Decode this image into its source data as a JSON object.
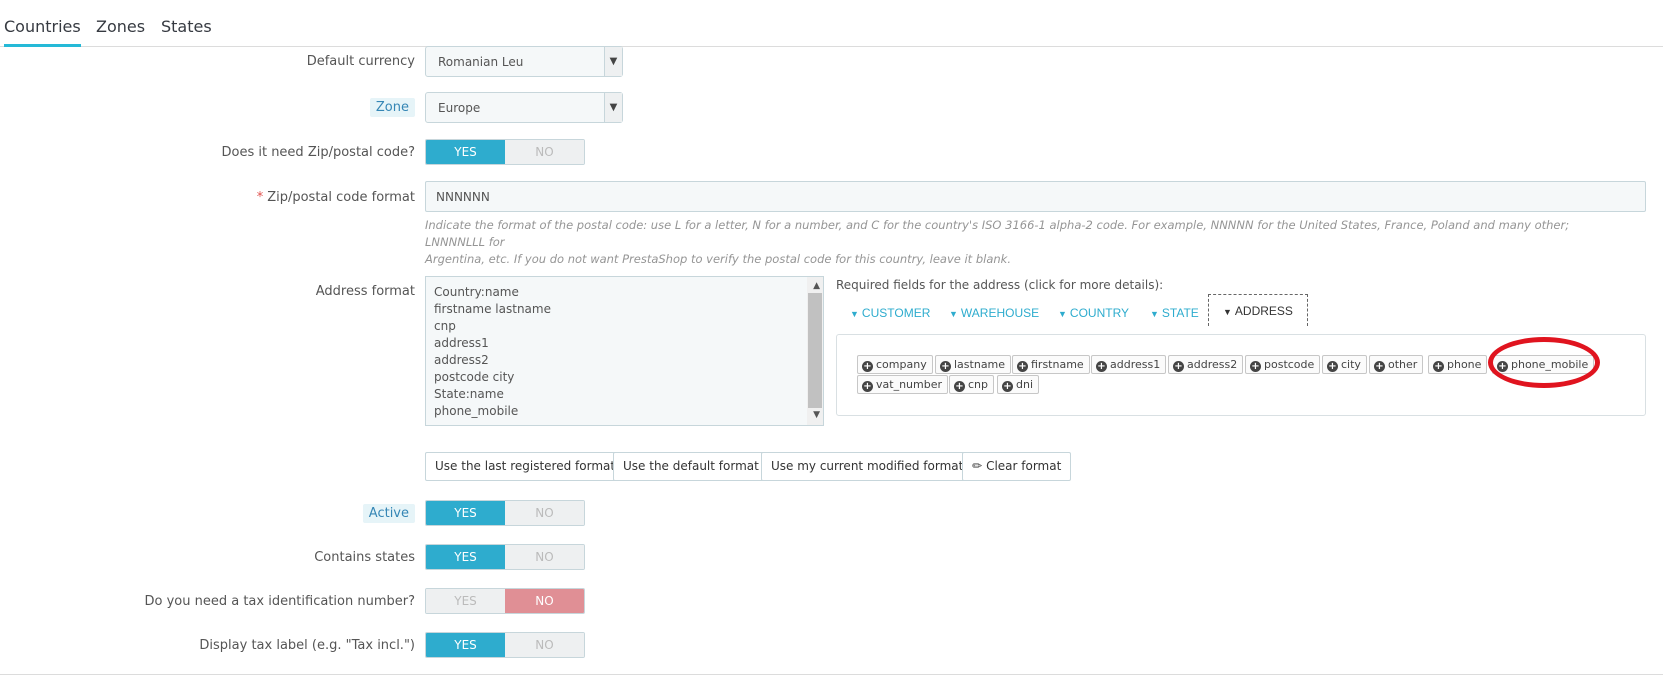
{
  "tabs": [
    "Countries",
    "Zones",
    "States"
  ],
  "fields": {
    "default_currency": {
      "label": "Default currency",
      "value": "Romanian Leu"
    },
    "zone": {
      "label": "Zone",
      "value": "Europe"
    },
    "need_zip": {
      "label": "Does it need Zip/postal code?",
      "yes": "YES",
      "no": "NO",
      "value": "YES"
    },
    "zip_format": {
      "required_mark": "*",
      "label": "Zip/postal code format",
      "value": "NNNNNN",
      "help_1": "Indicate the format of the postal code: use L for a letter, N for a number, and C for the country's ISO 3166-1 alpha-2 code. For example, NNNNN for the United States, France, Poland and many other; LNNNNLLL for",
      "help_2": "Argentina, etc. If you do not want PrestaShop to verify the postal code for this country, leave it blank."
    },
    "address_format": {
      "label": "Address format",
      "lines": [
        "Country:name",
        "firstname lastname",
        "cnp",
        "address1",
        "address2",
        "postcode city",
        "State:name",
        "phone_mobile"
      ]
    },
    "active": {
      "label": "Active",
      "yes": "YES",
      "no": "NO",
      "value": "YES"
    },
    "contains_states": {
      "label": "Contains states",
      "yes": "YES",
      "no": "NO",
      "value": "YES"
    },
    "need_tax_id": {
      "label": "Do you need a tax identification number?",
      "yes": "YES",
      "no": "NO",
      "value": "NO"
    },
    "display_tax_label": {
      "label": "Display tax label (e.g. \"Tax incl.\")",
      "yes": "YES",
      "no": "NO",
      "value": "YES"
    }
  },
  "required_fields": {
    "title": "Required fields for the address (click for more details):",
    "tabs": [
      "CUSTOMER",
      "WAREHOUSE",
      "COUNTRY",
      "STATE",
      "ADDRESS"
    ],
    "active_tab": "ADDRESS",
    "chips": [
      "company",
      "lastname",
      "firstname",
      "address1",
      "address2",
      "postcode",
      "city",
      "other",
      "phone",
      "phone_mobile",
      "vat_number",
      "cnp",
      "dni"
    ],
    "highlighted_chip": "phone_mobile"
  },
  "format_buttons": {
    "last_registered": "Use the last registered format",
    "default": "Use the default format",
    "current_modified": "Use my current modified format",
    "clear": "Clear format"
  },
  "colors": {
    "accent": "#2eacce",
    "no_active": "#e08f95",
    "annotation": "#e0141f"
  }
}
